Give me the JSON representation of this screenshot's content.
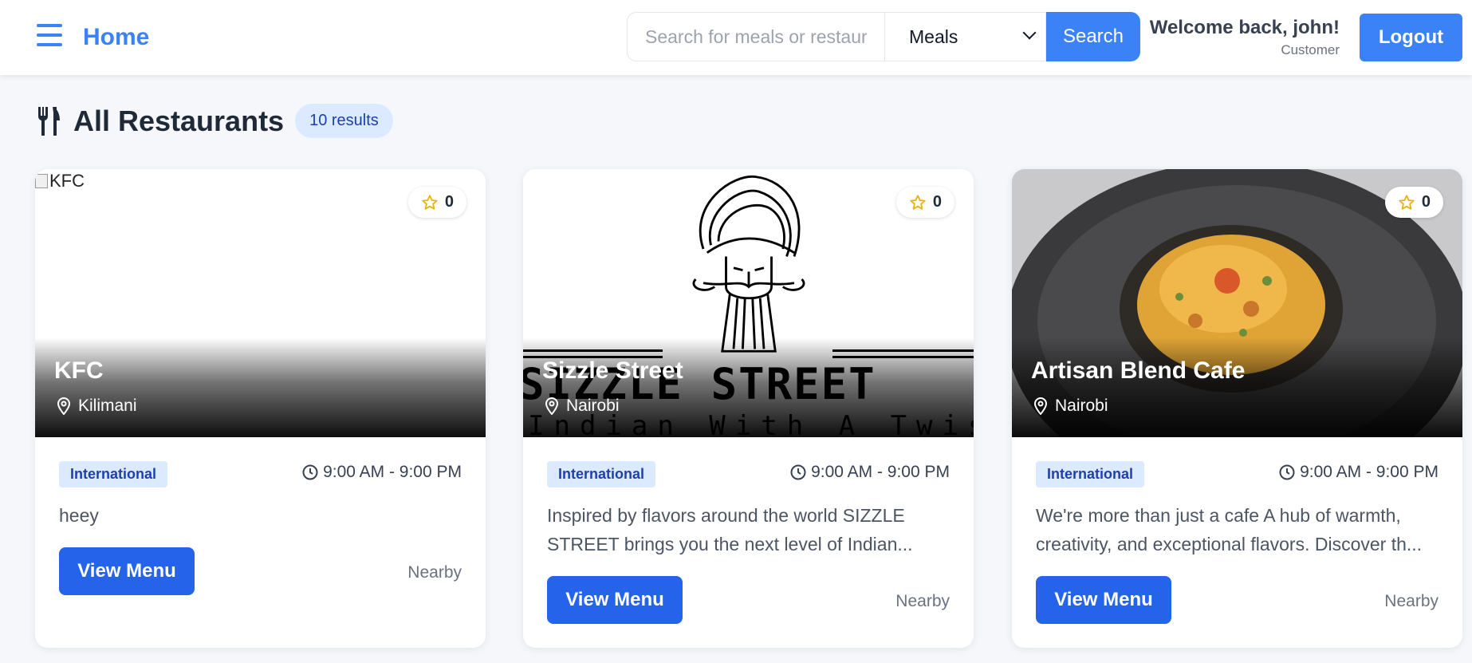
{
  "header": {
    "home_label": "Home",
    "search_placeholder": "Search for meals or restaurants",
    "search_type": "Meals",
    "search_button": "Search",
    "welcome": "Welcome back, john!",
    "role": "Customer",
    "logout": "Logout"
  },
  "section": {
    "title": "All Restaurants",
    "results": "10 results"
  },
  "icons": {
    "menu": "hamburger-icon",
    "section": "fork-knife-icon",
    "rating": "star-icon",
    "location": "map-pin-icon",
    "hours": "clock-icon"
  },
  "colors": {
    "primary": "#3b82f6",
    "button": "#2563eb",
    "badge_bg": "#dbeafe",
    "badge_text": "#1e40af",
    "star": "#eab308"
  },
  "restaurants": [
    {
      "name": "KFC",
      "image_alt": "KFC",
      "location": "Kilimani",
      "rating": "0",
      "cuisine": "International",
      "hours": "9:00 AM - 9:00 PM",
      "description": "heey",
      "button": "View Menu",
      "distance": "Nearby"
    },
    {
      "name": "Sizzle Street",
      "image_text": "SIZZLE STREET",
      "image_subtext": "Indian With A Twist",
      "location": "Nairobi",
      "rating": "0",
      "cuisine": "International",
      "hours": "9:00 AM - 9:00 PM",
      "description": "Inspired by flavors around the world SIZZLE STREET brings you the next level of Indian...",
      "button": "View Menu",
      "distance": "Nearby"
    },
    {
      "name": "Artisan Blend Cafe",
      "location": "Nairobi",
      "rating": "0",
      "cuisine": "International",
      "hours": "9:00 AM - 9:00 PM",
      "description": "We're more than just a cafe A hub of warmth, creativity, and exceptional flavors. Discover th...",
      "button": "View Menu",
      "distance": "Nearby"
    }
  ]
}
